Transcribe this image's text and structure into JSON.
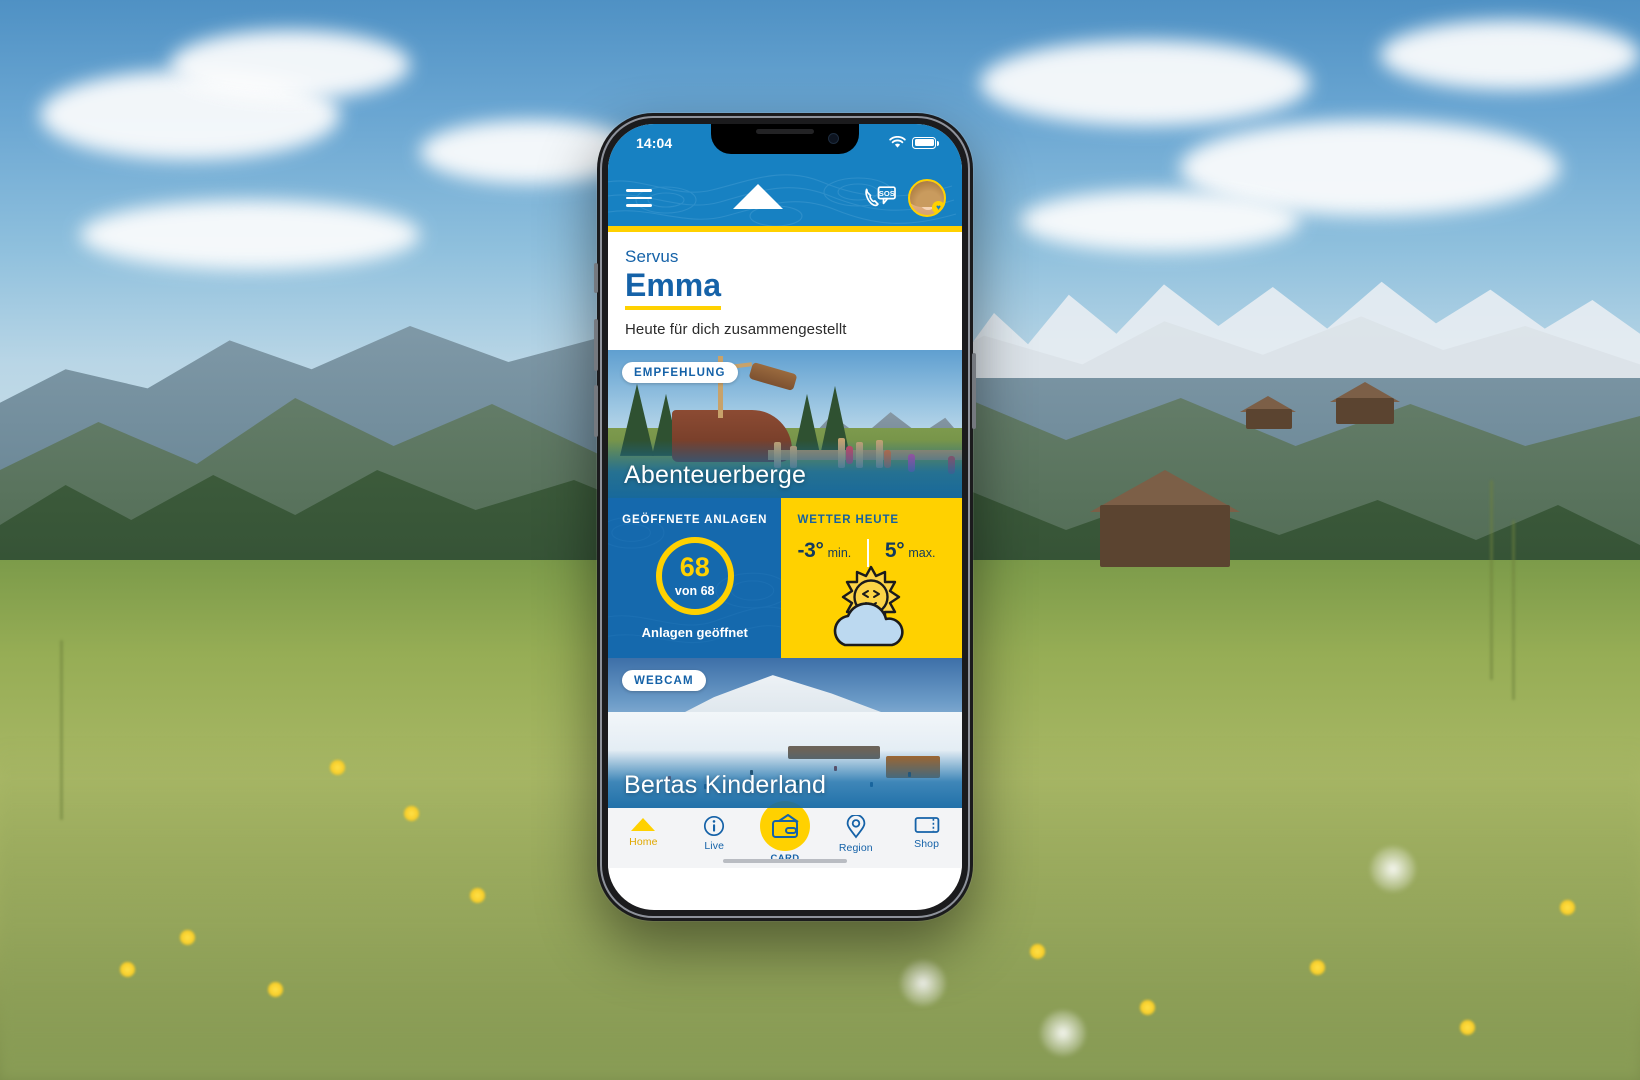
{
  "status_bar": {
    "time": "14:04",
    "wifi_icon": "wifi-icon",
    "battery_icon": "battery-icon"
  },
  "header": {
    "menu_icon": "hamburger-menu-icon",
    "logo_icon": "mountain-logo-icon",
    "sos_icon": "sos-call-icon",
    "avatar_name": "avatar",
    "avatar_badge_icon": "heart-icon",
    "background_color": "#1781c2",
    "accent_color": "#ffd100"
  },
  "greeting": {
    "salutation": "Servus",
    "name": "Emma",
    "subtitle": "Heute für dich zusammengestellt"
  },
  "recommendation_card": {
    "badge": "EMPFEHLUNG",
    "title": "Abenteuerberge"
  },
  "lifts_card": {
    "label": "GEÖFFNETE ANLAGEN",
    "open_count": "68",
    "of_total": "von 68",
    "footer": "Anlagen geöffnet",
    "background_color": "#1569ad",
    "ring_color": "#ffd100"
  },
  "weather_card": {
    "label": "WETTER HEUTE",
    "min_value": "-3°",
    "min_unit": "min.",
    "max_value": "5°",
    "max_unit": "max.",
    "icon": "sun-behind-cloud-icon",
    "background_color": "#ffd100"
  },
  "webcam_card": {
    "badge": "WEBCAM",
    "title": "Bertas Kinderland"
  },
  "bottom_nav": {
    "items": [
      {
        "label": "Home",
        "icon": "mountain-home-icon",
        "active": true
      },
      {
        "label": "Live",
        "icon": "info-circle-icon",
        "active": false
      },
      {
        "label": "CARD",
        "icon": "wallet-card-icon",
        "active": false
      },
      {
        "label": "Region",
        "icon": "map-pin-icon",
        "active": false
      },
      {
        "label": "Shop",
        "icon": "ticket-icon",
        "active": false
      }
    ]
  }
}
